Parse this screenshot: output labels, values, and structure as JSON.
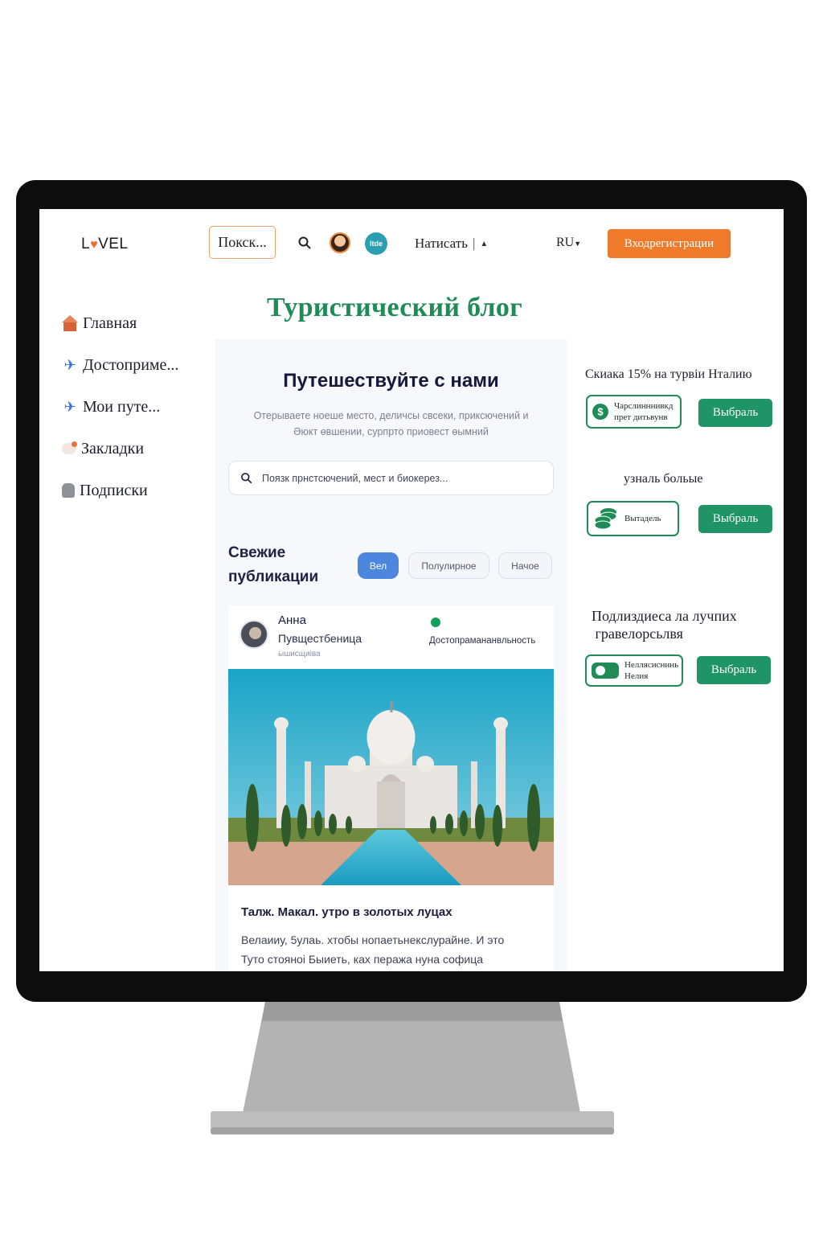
{
  "header": {
    "logo_prefix": "L",
    "logo_suffix": "VEL",
    "search_label": "Покск...",
    "avatar_badge": "ltde",
    "write_label": "Натисать",
    "write_separator": "|",
    "language": "RU",
    "login_label": "Входрегистрации"
  },
  "sidebar": {
    "items": [
      {
        "label": "Главная",
        "icon": "home-icon"
      },
      {
        "label": "Достоприме...",
        "icon": "airplane-icon"
      },
      {
        "label": "Мои путе...",
        "icon": "airplane-icon"
      },
      {
        "label": "Закладки",
        "icon": "bookmark-icon"
      },
      {
        "label": "Подписки",
        "icon": "subscriptions-icon"
      }
    ]
  },
  "page": {
    "title": "Туристический блог"
  },
  "hero": {
    "title": "Путешествуйте с нами",
    "description_line1": "Отерываете ноеше место, деличсы свсеки, приксючений и",
    "description_line2": "Әюкт өвшении, сурпрто приовест өымний",
    "search_placeholder": "Поязк прнстсючений, мест и биокерез..."
  },
  "feed": {
    "title_line1": "Свежие",
    "title_line2": "публикации",
    "filters": [
      "Вел",
      "Полулирное",
      "Начое"
    ],
    "active_filter": "Вел"
  },
  "post": {
    "author": "Анна",
    "role": "Пувщестбеница",
    "small_tag": "ышисщиіва",
    "category": "Достопрамананвльность",
    "status_color": "#14a05a",
    "image_subject": "taj-mahal-photo",
    "title": "Талж. Макал. утро в золотых луцах",
    "excerpt_line1": "Велаииу, 5улаь. хтобы нопаетьнекслурайне. И это",
    "excerpt_line2": "Туто стояноі Быиеть, ках пеража нуна софица"
  },
  "promos": [
    {
      "text": "Скиака 15% на турвіи Нталию",
      "card_line1": "Чарслинннивкд",
      "card_line2": "прет дитьвунв",
      "button": "Выбраль",
      "icon": "dollar-icon"
    },
    {
      "text": "узналь больые",
      "card_line1": "Вытадель",
      "card_line2": "",
      "button": "Выбраль",
      "icon": "coins-icon"
    },
    {
      "text_line1": "Подлиздиеса ла лучпих",
      "text_line2": "гравелорсьлвя",
      "card_line1": "Неллясиснинь",
      "card_line2": "Нелия",
      "button": "Выбраль",
      "icon": "toggle-icon"
    }
  ],
  "colors": {
    "accent_orange": "#f07a2c",
    "brand_green": "#1f8c58",
    "button_green": "#1f9466",
    "filter_blue": "#4c86de"
  }
}
